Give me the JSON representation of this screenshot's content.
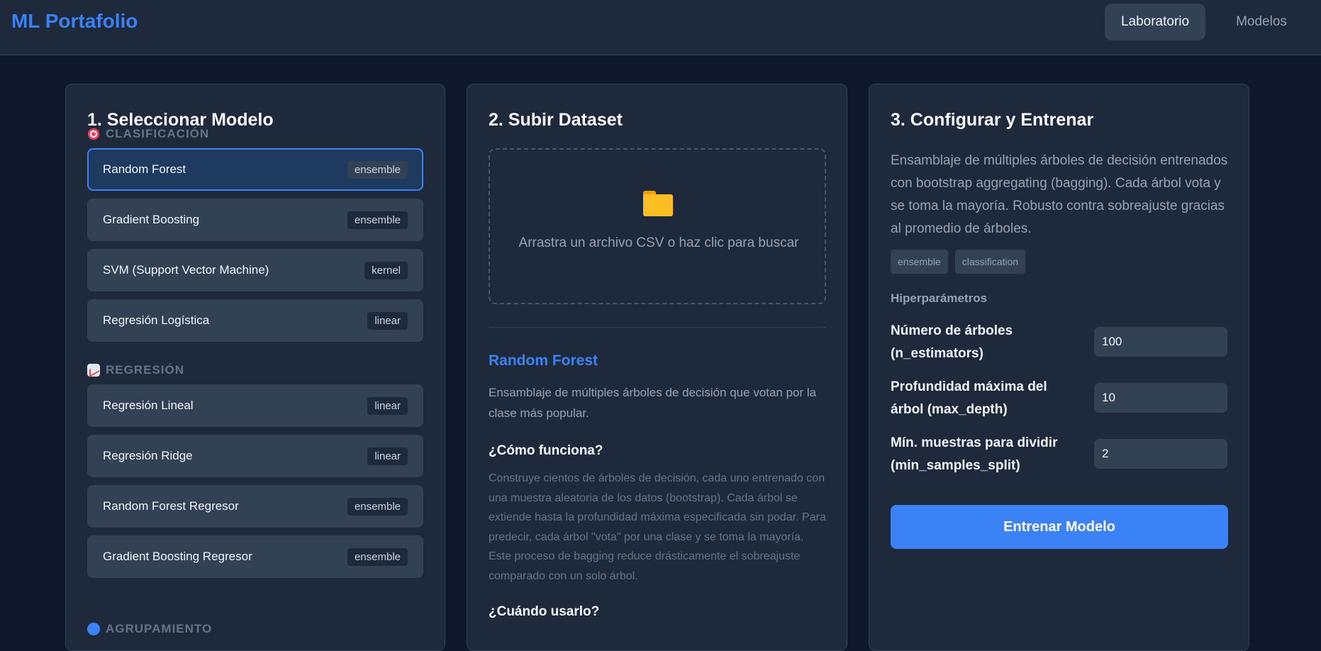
{
  "header": {
    "brand": "ML Portafolio",
    "nav": [
      {
        "label": "Laboratorio",
        "active": true
      },
      {
        "label": "Modelos",
        "active": false
      }
    ]
  },
  "select_panel": {
    "title": "1. Seleccionar Modelo",
    "groups": [
      {
        "label": "CLASIFICACIÓN",
        "icon": "target-icon",
        "models": [
          {
            "name": "Random Forest",
            "tag": "ensemble",
            "selected": true
          },
          {
            "name": "Gradient Boosting",
            "tag": "ensemble"
          },
          {
            "name": "SVM (Support Vector Machine)",
            "tag": "kernel"
          },
          {
            "name": "Regresión Logística",
            "tag": "linear"
          }
        ]
      },
      {
        "label": "REGRESIÓN",
        "icon": "chart-increasing-icon",
        "models": [
          {
            "name": "Regresión Lineal",
            "tag": "linear"
          },
          {
            "name": "Regresión Ridge",
            "tag": "linear"
          },
          {
            "name": "Random Forest Regresor",
            "tag": "ensemble"
          },
          {
            "name": "Gradient Boosting Regresor",
            "tag": "ensemble"
          }
        ]
      },
      {
        "label": "AGRUPAMIENTO",
        "icon": "blue-circle-icon",
        "models": []
      }
    ]
  },
  "upload_panel": {
    "title": "2. Subir Dataset",
    "dropzone_icon": "folder-icon",
    "dropzone_text": "Arrastra un archivo CSV o haz clic para buscar",
    "model_title": "Random Forest",
    "model_desc": "Ensamblaje de múltiples árboles de decisión que votan por la clase más popular.",
    "how_title": "¿Cómo funciona?",
    "how_text": "Construye cientos de árboles de decisión, cada uno entrenado con una muestra aleatoria de los datos (bootstrap). Cada árbol se extiende hasta la profundidad máxima especificada sin podar. Para predecir, cada árbol \"vota\" por una clase y se toma la mayoría. Este proceso de bagging reduce drásticamente el sobreajuste comparado con un solo árbol.",
    "when_title": "¿Cuándo usarlo?"
  },
  "config_panel": {
    "title": "3. Configurar y Entrenar",
    "description": "Ensamblaje de múltiples árboles de decisión entrenados con bootstrap aggregating (bagging). Cada árbol vota y se toma la mayoría. Robusto contra sobreajuste gracias al promedio de árboles.",
    "tags": [
      "ensemble",
      "classification"
    ],
    "hyperparams_label": "Hiperparámetros",
    "params": [
      {
        "label": "Número de árboles (n_estimators)",
        "value": "100"
      },
      {
        "label": "Profundidad máxima del árbol (max_depth)",
        "value": "10"
      },
      {
        "label": "Mín. muestras para dividir (min_samples_split)",
        "value": "2"
      }
    ],
    "train_button": "Entrenar Modelo"
  },
  "colors": {
    "accent": "#3b82f6",
    "background": "#0f172a",
    "card": "#1e293b"
  }
}
